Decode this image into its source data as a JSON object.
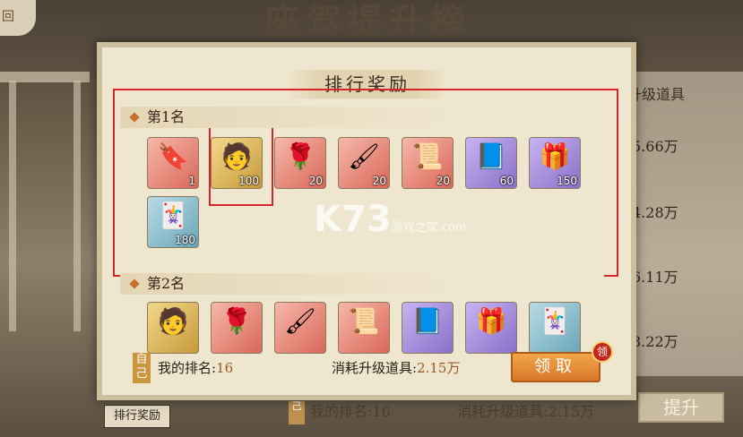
{
  "background": {
    "title": "座驾提升榜",
    "corner_label": "回",
    "right_panel": {
      "header": "升级道具",
      "values": [
        "5.66万",
        "4.28万",
        "6.11万",
        "8.22万"
      ]
    },
    "tab_label": "排行奖励",
    "self_badge": "己",
    "rank_text": "我的排名:16",
    "cost_text": "消耗升级道具:2.15万",
    "upgrade_button": "提升"
  },
  "dialog": {
    "title": "排行奖励",
    "sections": [
      {
        "label": "第1名",
        "items": [
          {
            "icon": "mount-token",
            "count": "1",
            "quality": "red"
          },
          {
            "icon": "character-card",
            "count": "100",
            "quality": "gold"
          },
          {
            "icon": "rose-dome",
            "count": "20",
            "quality": "red"
          },
          {
            "icon": "brush",
            "count": "20",
            "quality": "red"
          },
          {
            "icon": "scroll-stick",
            "count": "20",
            "quality": "red"
          },
          {
            "icon": "blue-book",
            "count": "60",
            "quality": "purple"
          },
          {
            "icon": "gift-box",
            "count": "150",
            "quality": "purple"
          },
          {
            "icon": "score-card",
            "count": "180",
            "quality": "blue"
          }
        ]
      },
      {
        "label": "第2名",
        "items": [
          {
            "icon": "character-card",
            "count": "",
            "quality": "gold"
          },
          {
            "icon": "rose-dome",
            "count": "",
            "quality": "red"
          },
          {
            "icon": "brush",
            "count": "",
            "quality": "red"
          },
          {
            "icon": "scroll-stick",
            "count": "",
            "quality": "red"
          },
          {
            "icon": "blue-book",
            "count": "",
            "quality": "purple"
          },
          {
            "icon": "gift-box",
            "count": "",
            "quality": "purple"
          },
          {
            "icon": "score-card",
            "count": "",
            "quality": "blue"
          }
        ]
      }
    ],
    "self_badge": "自己",
    "rank_label": "我的排名:",
    "rank_value": "16",
    "cost_label": "消耗升级道具:",
    "cost_value": "2.15万",
    "claim_button": "领取",
    "claim_badge": "领"
  },
  "watermark": {
    "brand": "K73",
    "sub": "游戏之家",
    "domain": ".com"
  }
}
